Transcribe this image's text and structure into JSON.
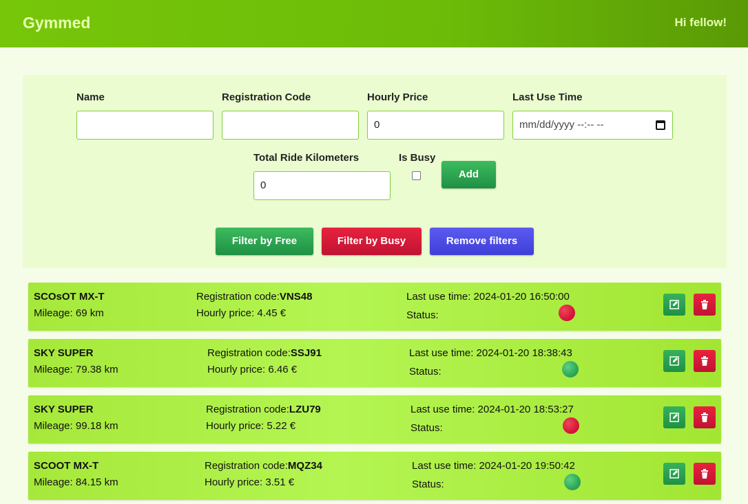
{
  "app": {
    "brand": "Gymmed",
    "greeting": "Hi fellow!"
  },
  "form": {
    "name_label": "Name",
    "name_value": "",
    "regcode_label": "Registration Code",
    "regcode_value": "",
    "price_label": "Hourly Price",
    "price_value": "0",
    "lastuse_label": "Last Use Time",
    "lastuse_placeholder": "mm/dd/yyyy --:-- --",
    "km_label": "Total Ride Kilometers",
    "km_value": "0",
    "busy_label": "Is Busy",
    "busy_checked": false,
    "add_label": "Add"
  },
  "filters": {
    "free_label": "Filter by Free",
    "busy_label": "Filter by Busy",
    "remove_label": "Remove filters"
  },
  "labels": {
    "mileage": "Mileage:",
    "km_unit": "km",
    "regcode": "Registration code:",
    "hourly": "Hourly price:",
    "currency": "€",
    "lastuse": "Last use time:",
    "status": "Status:"
  },
  "colors": {
    "busy": "#d8163a",
    "free": "#2ea85a",
    "brand": "#77c60a"
  },
  "scooters": [
    {
      "name": "SCOsOT MX-T",
      "mileage": "Mileage: 69 km",
      "regcode": "VNS48",
      "price": "Hourly price: 4.45 €",
      "lastuse": "Last use time: 2024-01-20 16:50:00",
      "status": "busy"
    },
    {
      "name": "SKY SUPER",
      "mileage": "Mileage: 79.38 km",
      "regcode": "SSJ91",
      "price": "Hourly price: 6.46 €",
      "lastuse": "Last use time: 2024-01-20 18:38:43",
      "status": "free"
    },
    {
      "name": "SKY SUPER",
      "mileage": "Mileage: 99.18 km",
      "regcode": "LZU79",
      "price": "Hourly price: 5.22 €",
      "lastuse": "Last use time: 2024-01-20 18:53:27",
      "status": "busy"
    },
    {
      "name": "SCOOT MX-T",
      "mileage": "Mileage: 84.15 km",
      "regcode": "MQZ34",
      "price": "Hourly price: 3.51 €",
      "lastuse": "Last use time: 2024-01-20 19:50:42",
      "status": "free"
    }
  ]
}
